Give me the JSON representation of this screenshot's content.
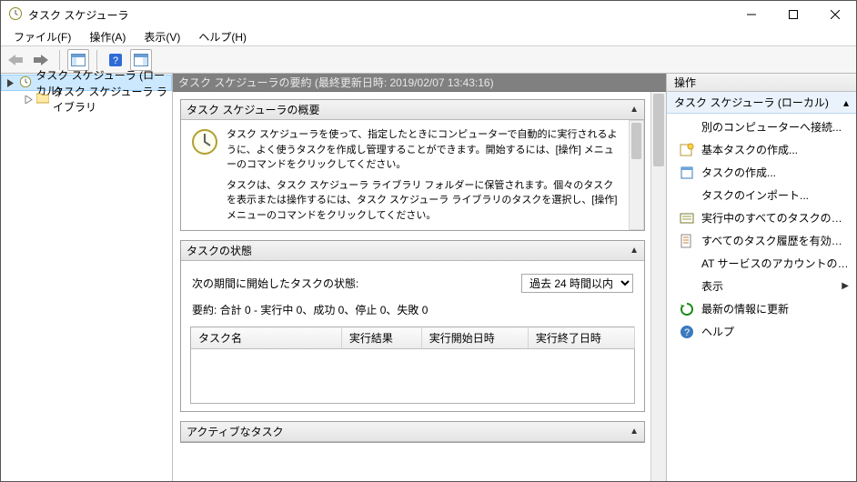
{
  "window": {
    "title": "タスク スケジューラ"
  },
  "menu": {
    "file": "ファイル(F)",
    "action": "操作(A)",
    "view": "表示(V)",
    "help": "ヘルプ(H)"
  },
  "tree": {
    "root": "タスク スケジューラ (ローカル)",
    "library": "タスク スケジューラ ライブラリ"
  },
  "center": {
    "header_title": "タスク スケジューラの要約 (最終更新日時: 2019/02/07 13:43:16)",
    "overview": {
      "title": "タスク スケジューラの概要",
      "para1": "タスク スケジューラを使って、指定したときにコンピューターで自動的に実行されるように、よく使うタスクを作成し管理することができます。開始するには、[操作] メニューのコマンドをクリックしてください。",
      "para2": "タスクは、タスク スケジューラ ライブラリ フォルダーに保管されます。個々のタスクを表示または操作するには、タスク スケジューラ ライブラリのタスクを選択し、[操作] メニューのコマンドをクリックしてください。"
    },
    "status": {
      "title": "タスクの状態",
      "period_label": "次の期間に開始したタスクの状態:",
      "period_value": "過去 24 時間以内",
      "summary": "要約: 合計 0 - 実行中 0、成功 0、停止 0、失敗 0",
      "columns": {
        "name": "タスク名",
        "result": "実行結果",
        "start": "実行開始日時",
        "end": "実行終了日時"
      }
    },
    "active": {
      "title": "アクティブなタスク"
    }
  },
  "actions": {
    "header": "操作",
    "group": "タスク スケジューラ (ローカル)",
    "items": {
      "connect": "別のコンピューターへ接続...",
      "create_basic": "基本タスクの作成...",
      "create": "タスクの作成...",
      "import": "タスクのインポート...",
      "running": "実行中のすべてのタスクの表示",
      "history": "すべてのタスク履歴を有効にする",
      "at_account": "AT サービスのアカウントの構成",
      "view": "表示",
      "refresh": "最新の情報に更新",
      "help": "ヘルプ"
    }
  }
}
